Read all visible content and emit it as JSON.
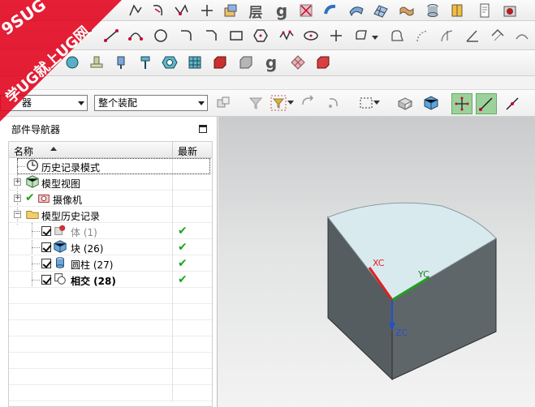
{
  "watermark": {
    "brand": "9SUG",
    "slogan": "学UG就上UG网"
  },
  "toolbar_row1": {
    "glyph_layer": "层",
    "glyph_g": "g"
  },
  "toolbar_row3": {
    "glyph_g": "g",
    "swatches": [
      "#e8303a",
      "#ee3fe0",
      "#f0a638",
      "#eaea2e",
      "#cfe35a",
      "#3fe23f",
      "#2fa34a"
    ]
  },
  "selectors": {
    "filter_value": "器",
    "assembly_value": "整个装配"
  },
  "navigator": {
    "title": "部件导航器",
    "col_name": "名称",
    "col_latest": "最新",
    "rows": [
      {
        "label": "历史记录模式",
        "latest": ""
      },
      {
        "label": "模型视图",
        "latest": ""
      },
      {
        "label": "摄像机",
        "latest": ""
      },
      {
        "label": "模型历史记录",
        "latest": ""
      },
      {
        "label": "体 (1)",
        "latest": "✔"
      },
      {
        "label": "块 (26)",
        "latest": "✔"
      },
      {
        "label": "圆柱 (27)",
        "latest": "✔"
      },
      {
        "label": "相交 (28)",
        "latest": "✔"
      }
    ]
  },
  "viewport": {
    "axes": {
      "x": "XC",
      "y": "YC",
      "z": "ZC"
    },
    "colors": {
      "top_face": "#d9eaef",
      "side_face": "#5c6366",
      "x_axis": "#e02020",
      "y_axis": "#20a020",
      "z_axis": "#2050d0"
    }
  }
}
